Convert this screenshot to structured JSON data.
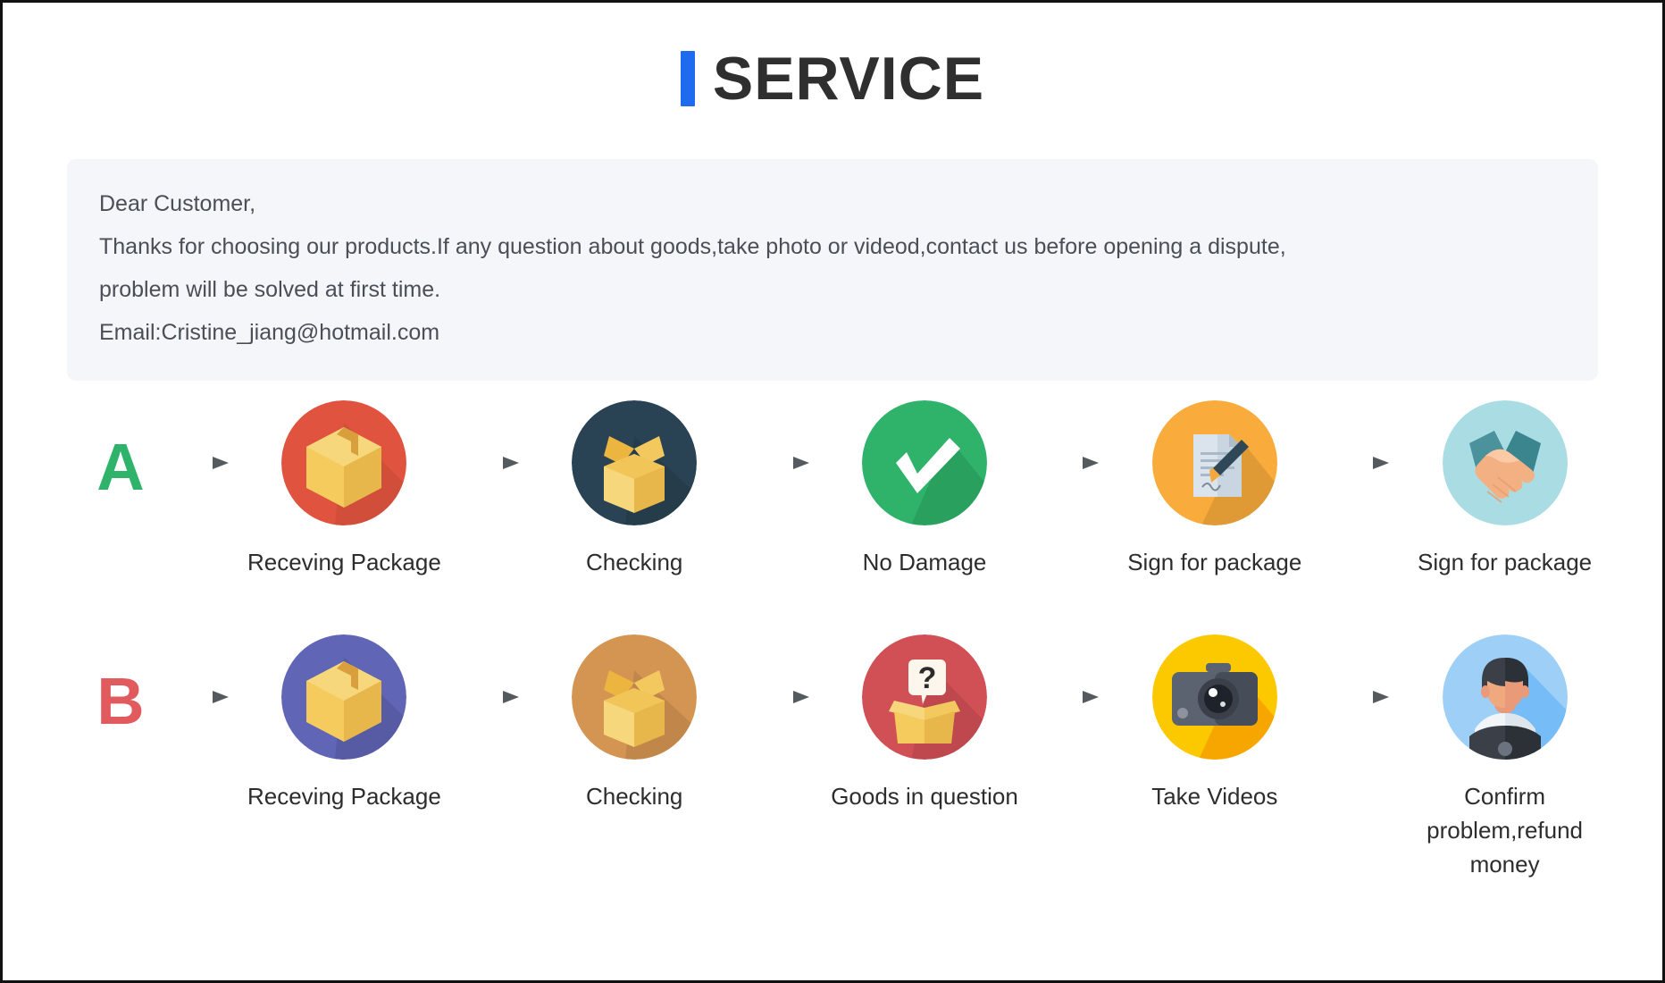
{
  "header": {
    "title": "SERVICE",
    "accent_color": "#1e6bf0",
    "title_color": "#2f2f2f"
  },
  "notice": {
    "background_color": "#f4f6f9",
    "lines": [
      "Dear Customer,",
      "Thanks for choosing our products.If any question about goods,take photo or videod,contact us before opening a dispute,",
      "problem will be solved at first time.",
      "Email:Cristine_jiang@hotmail.com"
    ]
  },
  "flows": [
    {
      "letter": "A",
      "letter_color": "#2fb36a",
      "steps": [
        {
          "label": "Receving Package",
          "icon": "closed-box-icon",
          "circle_color": "#e0543f"
        },
        {
          "label": "Checking",
          "icon": "open-box-icon",
          "circle_color": "#2a4354"
        },
        {
          "label": "No Damage",
          "icon": "checkmark-icon",
          "circle_color": "#2fb36a"
        },
        {
          "label": "Sign for package",
          "icon": "document-pen-icon",
          "circle_color": "#f9ab3c"
        },
        {
          "label": "Sign for package",
          "icon": "handshake-icon",
          "circle_color": "#a9dde3"
        }
      ]
    },
    {
      "letter": "B",
      "letter_color": "#e05a5e",
      "steps": [
        {
          "label": "Receving Package",
          "icon": "closed-box-icon",
          "circle_color": "#6065b5"
        },
        {
          "label": "Checking",
          "icon": "open-box-icon",
          "circle_color": "#d59552"
        },
        {
          "label": "Goods in question",
          "icon": "question-box-icon",
          "circle_color": "#d15055"
        },
        {
          "label": "Take Videos",
          "icon": "camera-icon",
          "circle_color": "#fcc800"
        },
        {
          "label": "Confirm problem,refund money",
          "icon": "support-agent-icon",
          "circle_color": "#9ed0f7"
        }
      ]
    }
  ]
}
